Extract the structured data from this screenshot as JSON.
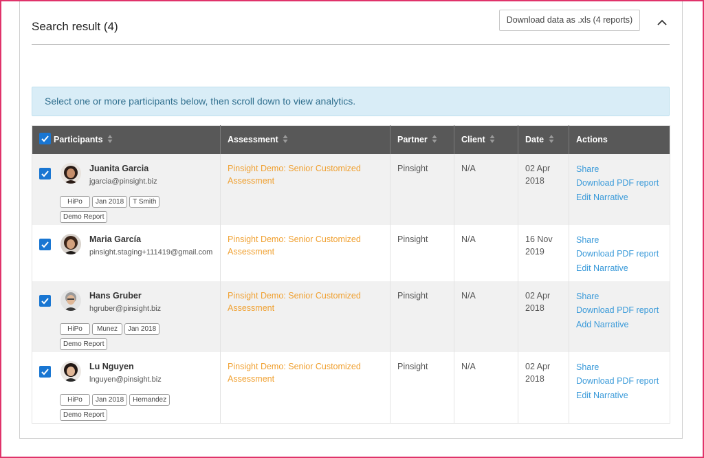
{
  "header": {
    "title": "Search result (4)",
    "download_label": "Download data as .xls (4 reports)"
  },
  "info_message": "Select one or more participants below, then scroll down to view analytics.",
  "table": {
    "columns": [
      "Participants",
      "Assessment",
      "Partner",
      "Client",
      "Date",
      "Actions"
    ],
    "rows": [
      {
        "name": "Juanita Garcia",
        "email": "jgarcia@pinsight.biz",
        "tags": [
          "HiPo",
          "Jan 2018",
          "T Smith",
          "Demo Report"
        ],
        "assessment": "Pinsight Demo: Senior Customized Assessment",
        "partner": "Pinsight",
        "client": "N/A",
        "date": "02 Apr 2018",
        "actions": [
          "Share",
          "Download PDF report",
          "Edit Narrative"
        ]
      },
      {
        "name": "Maria García",
        "email": "pinsight.staging+111419@gmail.com",
        "tags": [],
        "assessment": "Pinsight Demo: Senior Customized Assessment",
        "partner": "Pinsight",
        "client": "N/A",
        "date": "16 Nov 2019",
        "actions": [
          "Share",
          "Download PDF report",
          "Edit Narrative"
        ]
      },
      {
        "name": "Hans Gruber",
        "email": "hgruber@pinsight.biz",
        "tags": [
          "HiPo",
          "Munez",
          "Jan 2018",
          "Demo Report"
        ],
        "assessment": "Pinsight Demo: Senior Customized Assessment",
        "partner": "Pinsight",
        "client": "N/A",
        "date": "02 Apr 2018",
        "actions": [
          "Share",
          "Download PDF report",
          "Add Narrative"
        ]
      },
      {
        "name": "Lu Nguyen",
        "email": "lnguyen@pinsight.biz",
        "tags": [
          "HiPo",
          "Jan 2018",
          "Hernandez",
          "Demo Report"
        ],
        "assessment": "Pinsight Demo: Senior Customized Assessment",
        "partner": "Pinsight",
        "client": "N/A",
        "date": "02 Apr 2018",
        "actions": [
          "Share",
          "Download PDF report",
          "Edit Narrative"
        ]
      }
    ]
  },
  "colors": {
    "accent": "#1976d2",
    "assessment_link": "#f0a030",
    "action_link": "#3a9ad9",
    "header_bg": "#585858",
    "info_bg": "#d9edf7",
    "frame": "#e0336a"
  }
}
